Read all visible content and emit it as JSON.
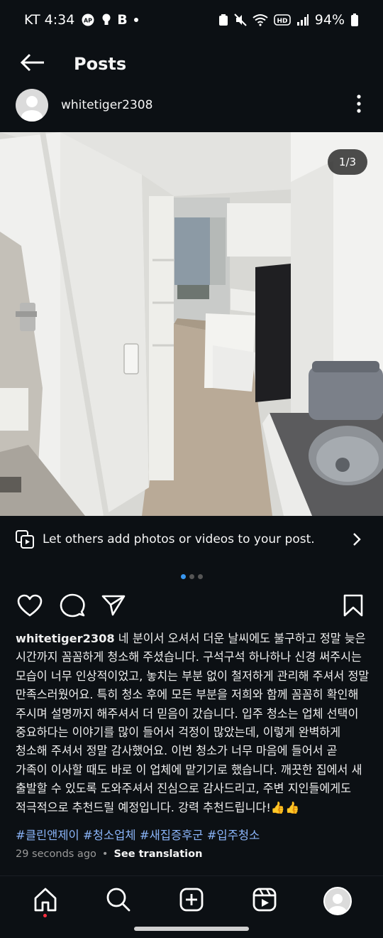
{
  "status_bar": {
    "carrier_time": "KT 4:34",
    "b_icon": "B",
    "battery": "94%",
    "icons_left": [
      "ap-icon",
      "bulb-icon",
      "b-icon",
      "dot-icon"
    ],
    "icons_right": [
      "battery-saver-icon",
      "mute-icon",
      "wifi-icon",
      "hd-icon",
      "signal-icon",
      "battery-icon"
    ]
  },
  "header": {
    "back_icon": "arrow-left-icon",
    "title": "Posts"
  },
  "post": {
    "author": "whitetiger2308",
    "more_icon": "more-vertical-icon",
    "photo_counter": "1/3",
    "image_description_icon": "room-photo",
    "collab_text": "Let others add photos or videos to your post.",
    "carousel_total": 3,
    "carousel_active": 1,
    "caption_user": "whitetiger2308",
    "caption_text": "네 분이서 오셔서 더운 날씨에도 불구하고 정말 늦은 시간까지 꼼꼼하게 청소해 주셨습니다. 구석구석 하나하나 신경 써주시는 모습이 너무 인상적이었고, 놓치는 부분 없이 철저하게 관리해 주셔서 정말 만족스러웠어요. 특히 청소 후에 모든 부분을 저희와 함께 꼼꼼히 확인해 주시며 설명까지 해주셔서 더 믿음이 갔습니다. 입주 청소는 업체 선택이 중요하다는 이야기를 많이 들어서 걱정이 많았는데, 이렇게 완벽하게 청소해 주셔서 정말 감사했어요. 이번 청소가 너무 마음에 들어서 곧 가족이 이사할 때도 바로 이 업체에 맡기기로 했습니다. 깨끗한 집에서 새 출발할 수 있도록 도와주셔서 진심으로 감사드리고, 주변 지인들에게도 적극적으로 추천드릴 예정입니다. 강력 추천드립니다!👍👍",
    "hashtags": "#클린앤제이 #청소업체 #새집증후군 #입주청소",
    "time_ago": "29 seconds ago",
    "separator": "•",
    "see_translation": "See translation"
  },
  "actions": {
    "like_icon": "heart-icon",
    "comment_icon": "comment-icon",
    "share_icon": "send-icon",
    "save_icon": "bookmark-icon"
  },
  "bottom_nav": [
    "home-icon",
    "search-icon",
    "create-icon",
    "reels-icon",
    "profile-avatar"
  ],
  "colors": {
    "background": "#0c1014",
    "hashtag": "#8ab4f8",
    "active_dot": "#3897f0",
    "notification_dot": "#ff3040"
  }
}
